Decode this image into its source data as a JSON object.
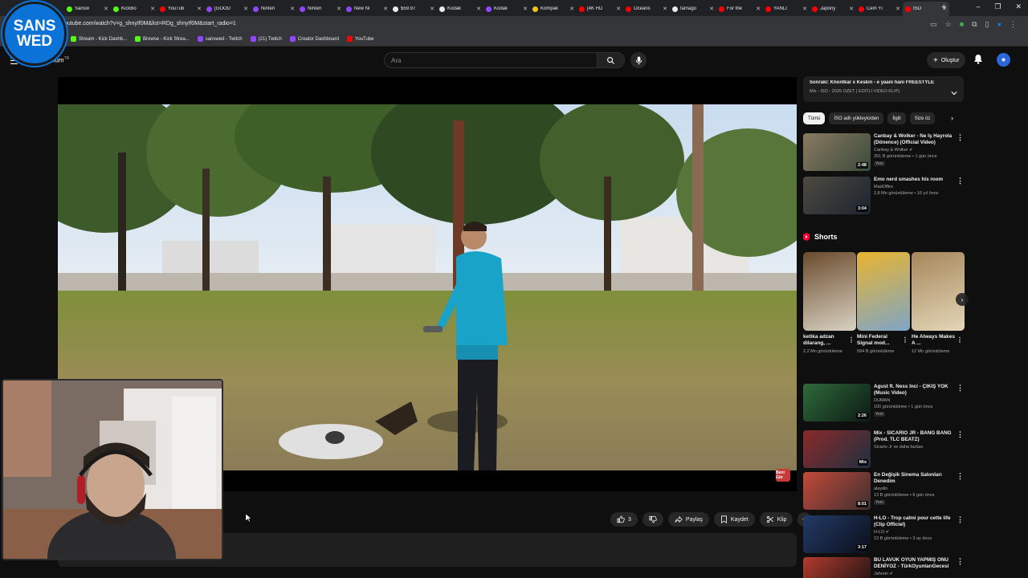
{
  "browser": {
    "tabs": [
      {
        "label": "Sansw",
        "color": "#53fc18"
      },
      {
        "label": "KickBo",
        "color": "#53fc18"
      },
      {
        "label": "YouTub",
        "color": "#ff0000"
      },
      {
        "label": "[GOOD",
        "color": "#9147ff"
      },
      {
        "label": "Ninten",
        "color": "#9147ff"
      },
      {
        "label": "Ninten",
        "color": "#9147ff"
      },
      {
        "label": "New Ni",
        "color": "#9147ff"
      },
      {
        "label": "$59.97",
        "color": "#e8eaed"
      },
      {
        "label": "Kodak",
        "color": "#e8eaed"
      },
      {
        "label": "Kodak",
        "color": "#9147ff"
      },
      {
        "label": "Kompak",
        "color": "#f4c20d"
      },
      {
        "label": "[4K HD",
        "color": "#ff0000"
      },
      {
        "label": "Oceans",
        "color": "#ff0000"
      },
      {
        "label": "tamago",
        "color": "#e8eaed"
      },
      {
        "label": "For the",
        "color": "#ff0000"
      },
      {
        "label": "YANLI",
        "color": "#ff0000"
      },
      {
        "label": "Japony",
        "color": "#ff0000"
      },
      {
        "label": "Cem Yı",
        "color": "#ff0000"
      },
      {
        "label": "ISO",
        "color": "#ff0000",
        "active": true
      }
    ],
    "new_tab": "+",
    "window_controls": [
      "–",
      "❐",
      "✕"
    ],
    "url": "outube.com/watch?v=g_shnyIf0M&list=RDg_shnyIf0M&start_radio=1",
    "bookmarks": [
      {
        "label": "Stream - Kick Dashb...",
        "color": "#53fc18"
      },
      {
        "label": "Browse - Kick Strea...",
        "color": "#53fc18"
      },
      {
        "label": "sanswed - Twitch",
        "color": "#9147ff"
      },
      {
        "label": "(21) Twitch",
        "color": "#9147ff"
      },
      {
        "label": "Creator Dashboard",
        "color": "#9147ff"
      },
      {
        "label": "YouTube",
        "color": "#ff0000"
      }
    ]
  },
  "logo": {
    "line1": "SANS",
    "line2": "WED"
  },
  "header": {
    "brand": "mium",
    "brand_sup": "TR",
    "search_placeholder": "Ara",
    "create_label": "Oluştur"
  },
  "player": {
    "watermark": "Beni Gör"
  },
  "actions": {
    "like_count": "3",
    "share": "Paylaş",
    "save": "Kaydet",
    "clip": "Klip"
  },
  "sidebar": {
    "next": {
      "title": "Sonraki: Khontkar x Keskin - e yaani hani FREESTYLE",
      "subtitle": "Mix - ISO - 2025 ÖZET ( EDİTLİ VİDEO KLİP)"
    },
    "chips": [
      {
        "label": "Tümü",
        "active": true
      },
      {
        "label": "İSO adlı yükleyiciden"
      },
      {
        "label": "İlgili"
      },
      {
        "label": "Size öz"
      }
    ],
    "videos_top": [
      {
        "title": "Canbay & Wolker - Ne İş Hayrola (Dönence) (Official Video)",
        "channel": "Canbay & Wolker ✔",
        "meta": "251 B görüntüleme • 1 gün önce",
        "badge": "Yeni",
        "duration": "2:48",
        "c1": "#8a7a62",
        "c2": "#3b4a3a"
      },
      {
        "title": "Emo nerd smashes his room",
        "channel": "MadOffire",
        "meta": "2,8 Mn görüntüleme • 16 yıl önce",
        "duration": "3:04",
        "c1": "#4d4a40",
        "c2": "#1c2430",
        "oneline": true
      }
    ],
    "shorts_title": "Shorts",
    "shorts": [
      {
        "title": "ketika adzan dilarang, ...",
        "views": "2,2 Mn görüntüleme",
        "c1": "#6a4b2c",
        "c2": "#d9d2c3"
      },
      {
        "title": "Mini Federal Signal mod...",
        "views": "594 B görüntüleme",
        "c1": "#e8b430",
        "c2": "#7fa5c6"
      },
      {
        "title": "He Always Makes A ...",
        "views": "12 Mn görüntüleme",
        "c1": "#a6865a",
        "c2": "#e3d6b8"
      }
    ],
    "videos_bottom": [
      {
        "title": "Agust ft. Ness Inci - ÇIKIŞ YOK (Music Video)",
        "channel": "DUMAN",
        "meta": "100 görüntüleme • 1 gün önce",
        "badge": "Yeni",
        "duration": "2:26",
        "c1": "#2f6a3a",
        "c2": "#0c1a14"
      },
      {
        "title": "Mix - SICARIO JR - BANG BANG (Prod. TLC BEATZ)",
        "channel": "Sicario Jr ve daha fazlası",
        "meta": "",
        "duration": "Mix",
        "c1": "#8b2a2a",
        "c2": "#203040"
      },
      {
        "title": "En Değişik Sinema Salonları Denedim",
        "channel": "alaydin",
        "meta": "13 B görüntüleme • 6 gün önce",
        "badge": "Yeni",
        "duration": "8:01",
        "c1": "#c24a3a",
        "c2": "#3e2f2f"
      },
      {
        "title": "H-LO - Trop calmi pour cette life (Clip Officiel)",
        "channel": "H-LO ✔",
        "meta": "13 B görüntüleme • 3 ay önce",
        "duration": "3:17",
        "c1": "#233a66",
        "c2": "#0b0f1a"
      },
      {
        "title": "BU LAVUK OYUN YAPMIŞ ONU DENİYOZ - TürkOyunlarıGecesi",
        "channel": "Jahrein ✔",
        "meta": "",
        "duration": "",
        "c1": "#b33b2e",
        "c2": "#101010"
      }
    ]
  }
}
